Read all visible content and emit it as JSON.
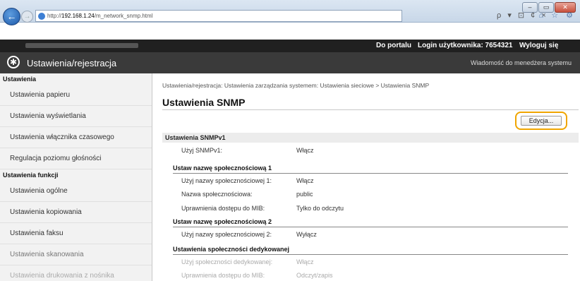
{
  "browser": {
    "url_prefix": "http://",
    "url_host": "192.168.1.24",
    "url_path": "/m_network_snmp.html",
    "address_tools": "ρ ▾ ⊡ ¢ ×",
    "tab_icons": "⌂ ☆ ⚙",
    "window_buttons": [
      "–",
      "▭",
      "✕"
    ]
  },
  "appbar": {
    "portal_label": "Do portalu",
    "login_label": "Login użytkownika: 7654321",
    "logout_label": "Wyloguj się"
  },
  "header": {
    "app_title": "Ustawienia/rejestracja",
    "admin_message": "Wiadomość do menedżera systemu"
  },
  "sidebar": {
    "section_settings": "Ustawienia",
    "items_settings": [
      "Ustawienia papieru",
      "Ustawienia wyświetlania",
      "Ustawienia włącznika czasowego",
      "Regulacja poziomu głośności"
    ],
    "section_functions": "Ustawienia funkcji",
    "items_functions": [
      "Ustawienia ogólne",
      "Ustawienia kopiowania",
      "Ustawienia faksu",
      "Ustawienia skanowania",
      "Ustawienia drukowania z nośnika"
    ]
  },
  "main": {
    "breadcrumb": "Ustawienia/rejestracja: Ustawienia zarządzania systemem: Ustawienia sieciowe > Ustawienia SNMP",
    "page_title": "Ustawienia SNMP",
    "edit_button": "Edycja...",
    "section_v1": "Ustawienia SNMPv1",
    "use_v1_label": "Użyj SNMPv1:",
    "use_v1_value": "Włącz",
    "community1_heading": "Ustaw nazwę społecznościową 1",
    "community1_use_label": "Użyj nazwy społecznościowej 1:",
    "community1_use_value": "Włącz",
    "community1_name_label": "Nazwa społecznościowa:",
    "community1_name_value": "public",
    "community1_mib_label": "Uprawnienia dostępu do MIB:",
    "community1_mib_value": "Tylko do odczytu",
    "community2_heading": "Ustaw nazwę społecznościową 2",
    "community2_use_label": "Użyj nazwy społecznościowej 2:",
    "community2_use_value": "Wyłącz",
    "dedicated_heading": "Ustawienia społeczności dedykowanej",
    "dedicated_use_label": "Użyj społeczności dedykowanej:",
    "dedicated_use_value": "Włącz",
    "dedicated_mib_label": "Uprawnienia dostępu do MIB:",
    "dedicated_mib_value": "Odczyt/zapis"
  },
  "colors": {
    "edit_highlight": "#f0a500",
    "appbar_bg": "#202020",
    "titlebar_bg": "#3a3a3a"
  }
}
